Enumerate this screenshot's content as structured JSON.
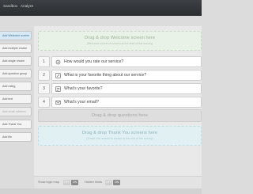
{
  "topbar": {
    "nav": [
      "Sandbox",
      "Analyze"
    ]
  },
  "sidebar": {
    "items": [
      {
        "label": "Add Welcome screen",
        "state": "active"
      },
      {
        "label": "Add multiple choice",
        "state": "normal"
      },
      {
        "label": "Add single choice",
        "state": "normal"
      },
      {
        "label": "Add question group",
        "state": "normal"
      },
      {
        "label": "Add rating",
        "state": "normal"
      },
      {
        "label": "Add text",
        "state": "normal"
      },
      {
        "label": "Add email address",
        "state": "faded"
      },
      {
        "label": "Add Thank You",
        "state": "normal"
      },
      {
        "label": "Add file",
        "state": "normal"
      }
    ]
  },
  "welcome_drop": {
    "title": "Drag & drop Welcome screen here",
    "hint": "(Welcome screen is shown at the start of the survey)"
  },
  "questions": [
    {
      "number": "1",
      "icon": "rating-icon",
      "text": "How would you rate our service?"
    },
    {
      "number": "2",
      "icon": "edit-icon",
      "text": "What is your favorite thing about our service?"
    },
    {
      "number": "3",
      "icon": "text-icon",
      "text": "What's your favorite?"
    },
    {
      "number": "4",
      "icon": "email-icon",
      "text": "What's your email?"
    }
  ],
  "questions_drop": {
    "title": "Drag & drop questions here"
  },
  "thanks_drop": {
    "title": "Drag & drop Thank You screens here",
    "hint": "(Thank You screen is shown at the end of the survey)"
  },
  "bottombar": {
    "logic_label": "Show logic map",
    "logic_toggle": {
      "off": "OFF",
      "on": "ON"
    },
    "hidden_label": "Hidden fields",
    "hidden_toggle": {
      "off": "OFF",
      "on": "ON"
    }
  }
}
